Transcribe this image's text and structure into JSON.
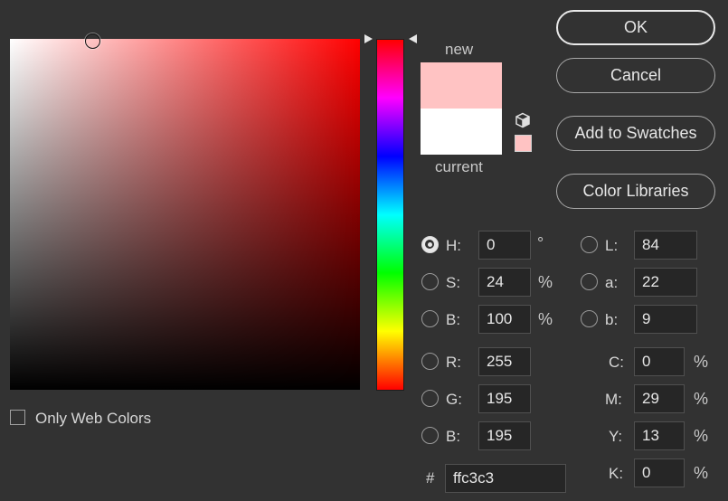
{
  "picker": {
    "new_label": "new",
    "current_label": "current",
    "new_color": "#ffc3c3",
    "current_color": "#ffffff",
    "only_web_colors_label": "Only Web Colors",
    "only_web_colors_checked": false
  },
  "buttons": {
    "ok": "OK",
    "cancel": "Cancel",
    "add_to_swatches": "Add to Swatches",
    "color_libraries": "Color Libraries"
  },
  "hsb": {
    "h": {
      "label": "H:",
      "value": "0",
      "unit": "°",
      "selected": true
    },
    "s": {
      "label": "S:",
      "value": "24",
      "unit": "%"
    },
    "b": {
      "label": "B:",
      "value": "100",
      "unit": "%"
    }
  },
  "rgb": {
    "r": {
      "label": "R:",
      "value": "255"
    },
    "g": {
      "label": "G:",
      "value": "195"
    },
    "b": {
      "label": "B:",
      "value": "195"
    }
  },
  "lab": {
    "l": {
      "label": "L:",
      "value": "84"
    },
    "a": {
      "label": "a:",
      "value": "22"
    },
    "b": {
      "label": "b:",
      "value": "9"
    }
  },
  "cmyk": {
    "c": {
      "label": "C:",
      "value": "0",
      "unit": "%"
    },
    "m": {
      "label": "M:",
      "value": "29",
      "unit": "%"
    },
    "y": {
      "label": "Y:",
      "value": "13",
      "unit": "%"
    },
    "k": {
      "label": "K:",
      "value": "0",
      "unit": "%"
    }
  },
  "hex": {
    "label": "#",
    "value": "ffc3c3"
  },
  "icons": {
    "cube": "cube-icon",
    "field_cursor": "circle-cursor-icon"
  }
}
